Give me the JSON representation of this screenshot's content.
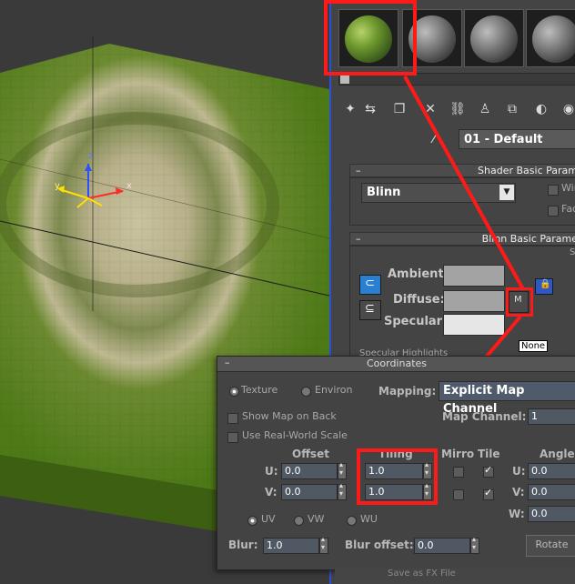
{
  "material_editor": {
    "material_name": "01 - Default",
    "shader_rollout_title": "Shader Basic Param",
    "shader_type": "Blinn",
    "wire_label": "Wir",
    "faceted_label": "Fac",
    "blinn_rollout_title": "Blinn Basic Parame",
    "ambient_label": "Ambient:",
    "diffuse_label": "Diffuse:",
    "specular_label": "Specular:",
    "map_button_label": "M",
    "tooltip": "None",
    "specular_highlights_label": "Specular Highlights",
    "self_illum_label": "S"
  },
  "coordinates": {
    "title": "Coordinates",
    "texture_label": "Texture",
    "environ_label": "Environ",
    "mapping_label": "Mapping:",
    "mapping_value": "Explicit Map Channel",
    "show_map_on_back_label": "Show Map on Back",
    "map_channel_label": "Map Channel:",
    "map_channel_value": "1",
    "use_real_world_label": "Use Real-World Scale",
    "offset_header": "Offset",
    "tiling_header": "Tiling",
    "mirror_header": "Mirro",
    "tile_header": "Tile",
    "angle_header": "Angle",
    "u_label": "U:",
    "v_label": "V:",
    "w_label": "W:",
    "offset_u": "0.0",
    "offset_v": "0.0",
    "tiling_u": "1.0",
    "tiling_v": "1.0",
    "angle_u": "0.0",
    "angle_v": "0.0",
    "angle_w": "0.0",
    "uv_label": "UV",
    "vw_label": "VW",
    "wu_label": "WU",
    "blur_label": "Blur:",
    "blur_value": "1.0",
    "blur_offset_label": "Blur offset:",
    "blur_offset_value": "0.0",
    "rotate_label": "Rotate",
    "save_label": "Save as FX File"
  },
  "viewport": {
    "axis_x": "x",
    "axis_y": "y",
    "axis_z": "z"
  },
  "colors": {
    "highlight": "#ff1a1a",
    "ambient": "#a3a3a3",
    "diffuse": "#a3a3a3",
    "specular": "#e6e6e6",
    "viewport_divider": "#2a4fd8"
  }
}
